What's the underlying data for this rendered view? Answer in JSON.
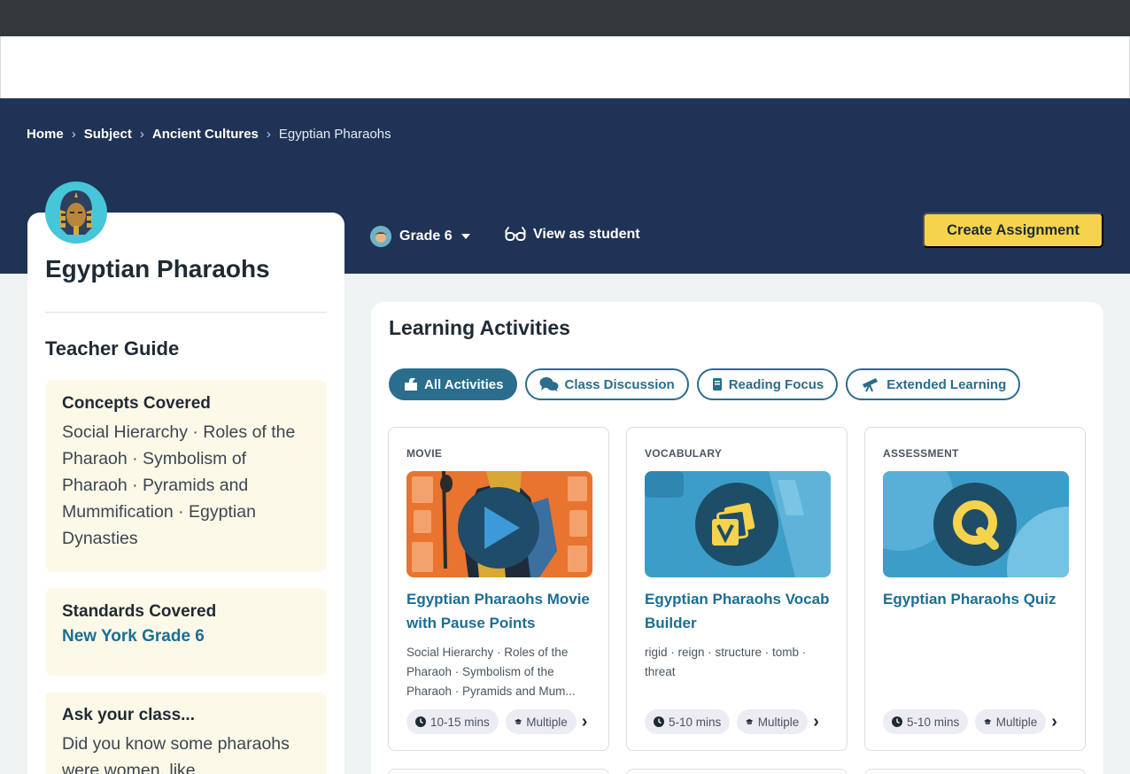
{
  "breadcrumb": {
    "items": [
      "Home",
      "Subject",
      "Ancient Cultures"
    ],
    "current": "Egyptian Pharaohs"
  },
  "topic": {
    "title": "Egyptian Pharaohs"
  },
  "teacher_guide": {
    "heading": "Teacher Guide",
    "concepts": {
      "title": "Concepts Covered",
      "text": "Social Hierarchy · Roles of the Pharaoh · Symbolism of Pharaoh · Pyramids and Mummification · Egyptian Dynasties"
    },
    "standards": {
      "title": "Standards Covered",
      "link": "New York Grade 6"
    },
    "ask": {
      "title": "Ask your class...",
      "text": "Did you know some pharaohs were women, like"
    }
  },
  "toolbar": {
    "grade_label": "Grade 6",
    "view_as_student": "View as student",
    "create_assignment": "Create Assignment"
  },
  "activities": {
    "heading": "Learning Activities",
    "filters": [
      {
        "label": "All Activities",
        "icon": "puzzle-icon",
        "active": true
      },
      {
        "label": "Class Discussion",
        "icon": "chat-bubbles-icon",
        "active": false
      },
      {
        "label": "Reading Focus",
        "icon": "book-icon",
        "active": false
      },
      {
        "label": "Extended Learning",
        "icon": "telescope-icon",
        "active": false
      }
    ],
    "cards": [
      {
        "type": "MOVIE",
        "title": "Egyptian Pharaohs Movie with Pause Points",
        "description": "Social Hierarchy · Roles of the Pharaoh · Symbolism of the Pharaoh · Pyramids and Mum...",
        "duration": "10-15 mins",
        "grouping": "Multiple"
      },
      {
        "type": "VOCABULARY",
        "title": "Egyptian Pharaohs Vocab Builder",
        "description": "rigid · reign · structure · tomb · threat",
        "duration": "5-10 mins",
        "grouping": "Multiple"
      },
      {
        "type": "ASSESSMENT",
        "title": "Egyptian Pharaohs Quiz",
        "description": "",
        "duration": "5-10 mins",
        "grouping": "Multiple"
      }
    ]
  },
  "colors": {
    "navy": "#1f3356",
    "accent_teal": "#2a6d8c",
    "button_yellow": "#f5d34c",
    "guide_box": "#fdf9e8"
  }
}
